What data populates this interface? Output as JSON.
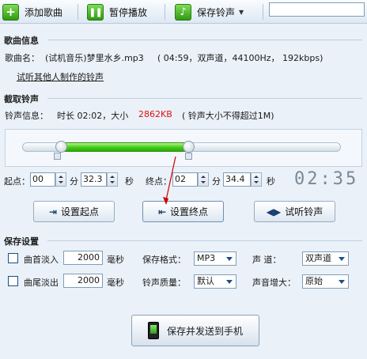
{
  "toolbar": {
    "add_song": "添加歌曲",
    "pause": "暂停播放",
    "save_ringtone": "保存铃声",
    "search_value": ""
  },
  "song_info": {
    "section_title": "歌曲信息",
    "name_label": "歌曲名：",
    "name_value": "(试机音乐)梦里水乡.mp3",
    "details": "( 04:59，双声道，44100Hz，  192kbps)",
    "link": "试听其他人制作的铃声"
  },
  "cut": {
    "section_title": "截取铃声",
    "info_label": "铃声信息：",
    "duration_text": "时长 02:02，大小",
    "size": "2862KB",
    "limit_note": "( 铃声大小不得超过1M)",
    "start_pct": 11,
    "end_pct": 52,
    "start_label": "起点：",
    "start_min": "00",
    "min_unit": "分",
    "start_sec": "32.3",
    "sec_unit": "秒",
    "end_label": "终点：",
    "end_min": "02",
    "end_sec": "34.4",
    "timer": "02:35",
    "btn_set_start": "设置起点",
    "btn_set_end": "设置终点",
    "btn_preview": "试听铃声"
  },
  "save": {
    "section_title": "保存设置",
    "fade_in": "曲首淡入",
    "fade_in_ms": "2000",
    "fade_out": "曲尾淡出",
    "fade_out_ms": "2000",
    "ms_unit": "毫秒",
    "format_label": "保存格式：",
    "format_value": "MP3",
    "quality_label": "铃声质量：",
    "quality_value": "默认",
    "channel_label": "声    道：",
    "channel_value": "双声道",
    "volume_label": "声音增大：",
    "volume_value": "原始",
    "save_send": "保存并发送到手机"
  }
}
